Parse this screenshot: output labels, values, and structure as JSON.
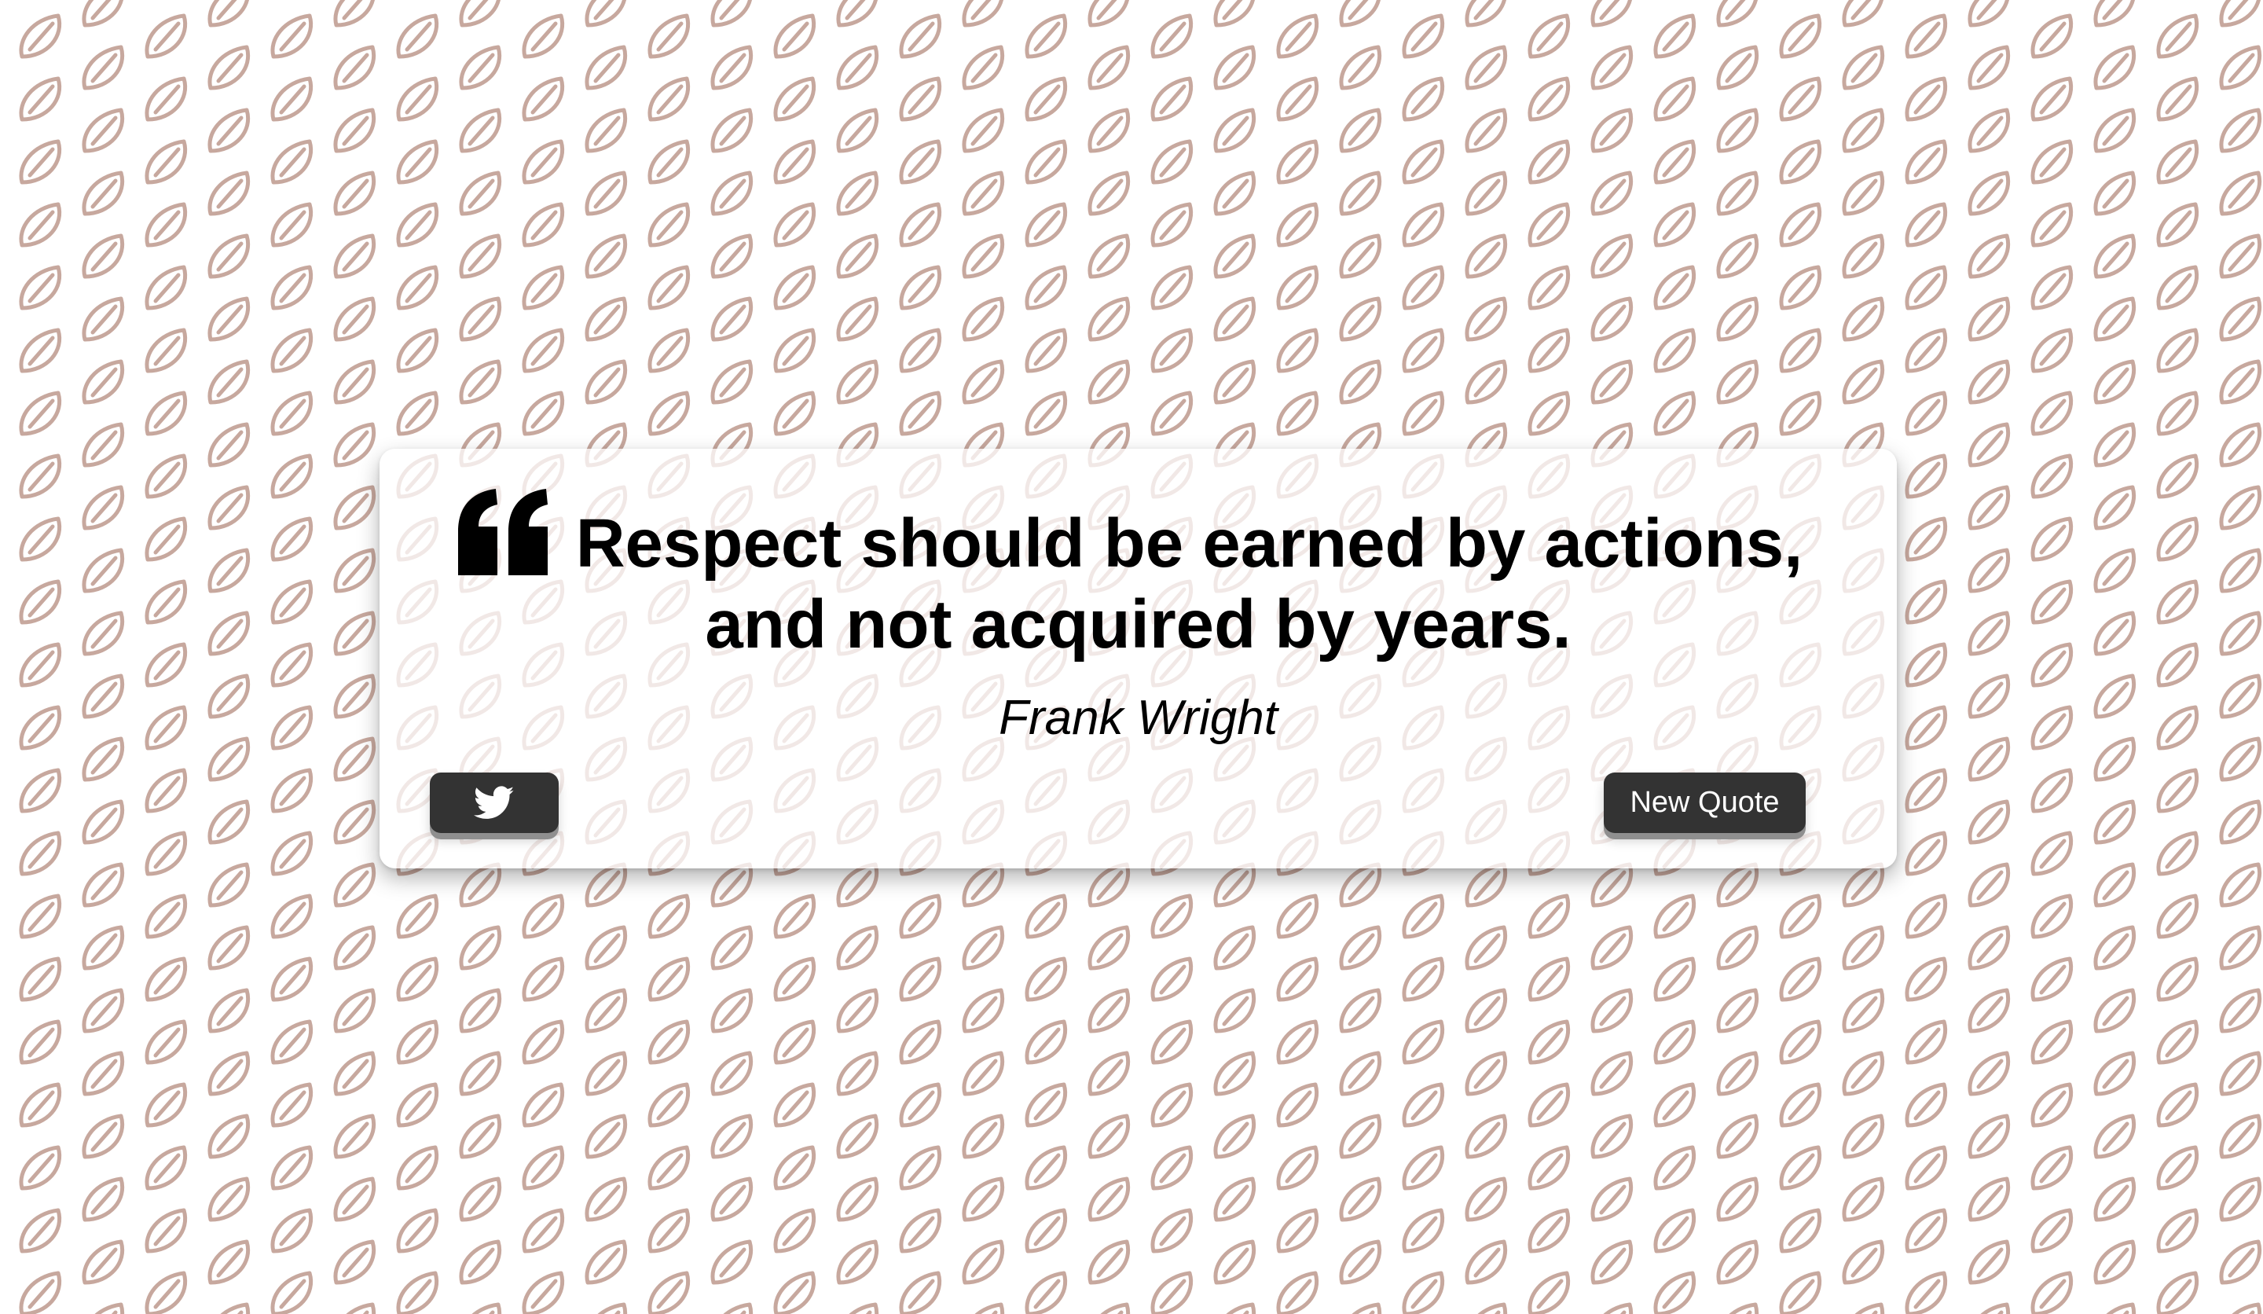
{
  "page": {
    "background_color": "#ffffff",
    "pattern_color": "#c7a89e",
    "pattern_icon": "leaf-icon"
  },
  "quote": {
    "mark_icon": "quote-left-icon",
    "line_1": "Respect should be earned by actions,",
    "line_2": "and not acquired by years.",
    "author": "Frank Wright"
  },
  "actions": {
    "tweet_icon": "twitter-icon",
    "new_quote_label": "New Quote",
    "button_color": "#333333"
  }
}
